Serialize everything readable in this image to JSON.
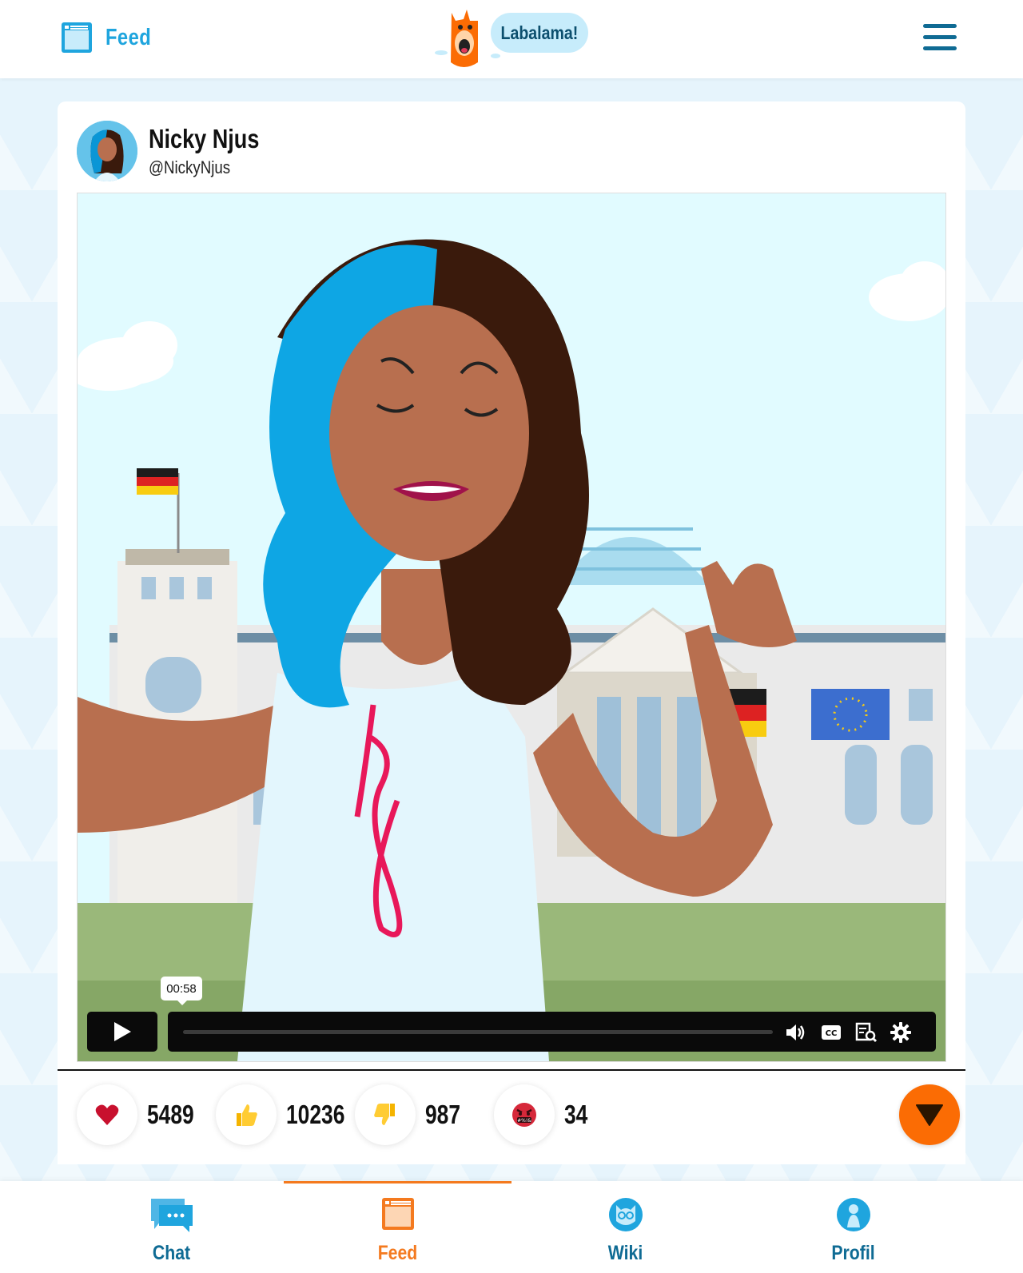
{
  "header": {
    "section_label": "Feed",
    "logo_text": "Labalama!"
  },
  "post": {
    "author_name": "Nicky Njus",
    "author_handle": "@NickyNjus",
    "video": {
      "current_time_tooltip": "00:58",
      "progress": 0.0
    },
    "reactions": [
      {
        "icon": "heart-icon",
        "count": "5489"
      },
      {
        "icon": "thumbs-up-icon",
        "count": "10236"
      },
      {
        "icon": "thumbs-down-icon",
        "count": "987"
      },
      {
        "icon": "angry-face-icon",
        "count": "34"
      }
    ]
  },
  "bottom_nav": {
    "items": [
      {
        "label": "Chat",
        "icon": "chat-icon",
        "active": false
      },
      {
        "label": "Feed",
        "icon": "feed-icon",
        "active": true
      },
      {
        "label": "Wiki",
        "icon": "wiki-owl-icon",
        "active": false
      },
      {
        "label": "Profil",
        "icon": "profile-icon",
        "active": false
      }
    ]
  },
  "colors": {
    "brand_blue": "#1fa5de",
    "dark_blue": "#0f6b94",
    "accent_orange": "#fb6c04",
    "active_nav": "#f47a1f"
  }
}
